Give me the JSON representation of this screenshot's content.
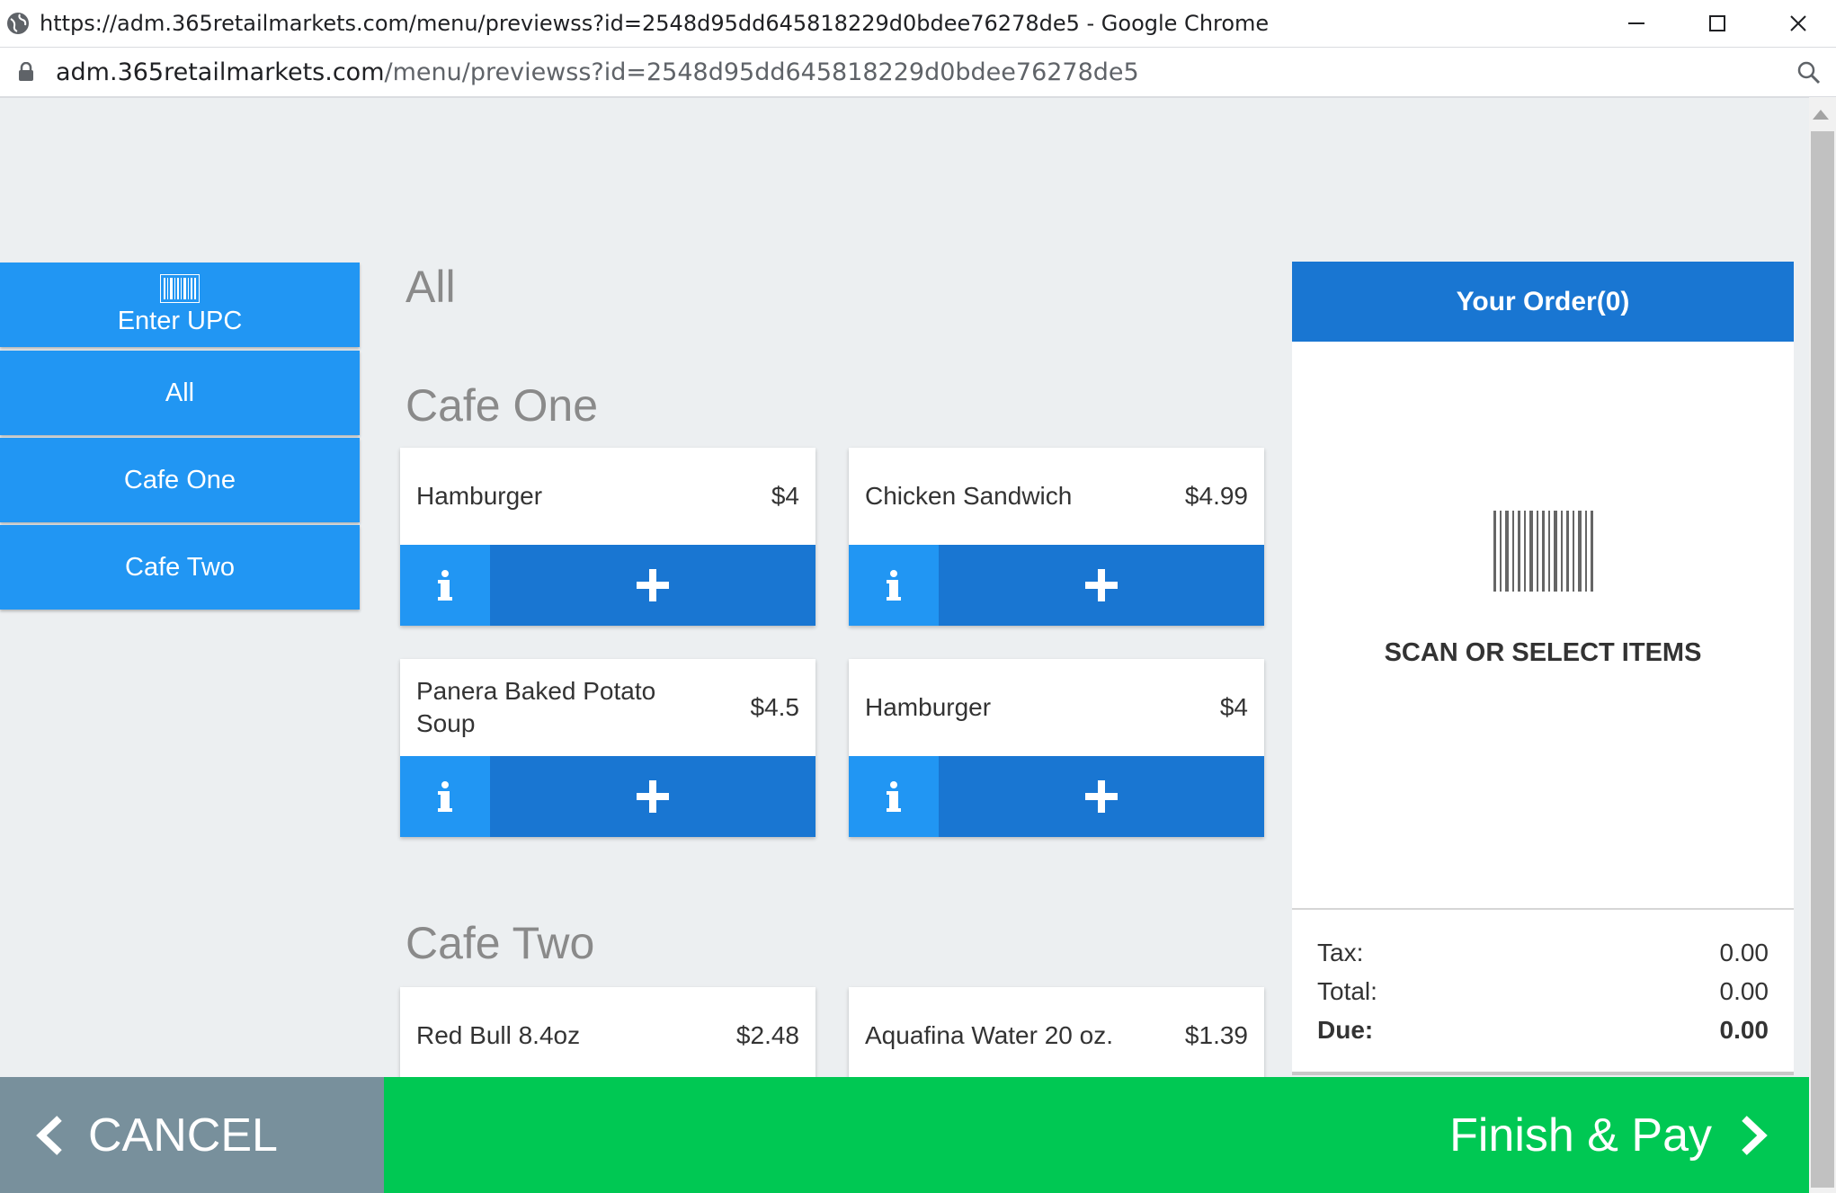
{
  "browser": {
    "window_title": "https://adm.365retailmarkets.com/menu/previewss?id=2548d95dd645818229d0bdee76278de5 - Google Chrome",
    "url_host": "adm.365retailmarkets.com",
    "url_path": "/menu/previewss?id=2548d95dd645818229d0bdee76278de5"
  },
  "sidebar": {
    "upc_label": "Enter UPC",
    "items": [
      {
        "label": "All"
      },
      {
        "label": "Cafe One"
      },
      {
        "label": "Cafe Two"
      }
    ]
  },
  "menu": {
    "current_category": "All",
    "sections": [
      {
        "title": "Cafe One",
        "items": [
          {
            "name": "Hamburger",
            "price": "$4"
          },
          {
            "name": "Chicken Sandwich",
            "price": "$4.99"
          },
          {
            "name": "Panera Baked Potato Soup",
            "price": "$4.5"
          },
          {
            "name": "Hamburger",
            "price": "$4"
          }
        ]
      },
      {
        "title": "Cafe Two",
        "items": [
          {
            "name": "Red Bull 8.4oz",
            "price": "$2.48"
          },
          {
            "name": "Aquafina Water 20 oz.",
            "price": "$1.39"
          }
        ]
      }
    ]
  },
  "order": {
    "title": "Your Order(0)",
    "empty_message": "SCAN OR SELECT ITEMS",
    "tax_label": "Tax:",
    "tax_value": "0.00",
    "total_label": "Total:",
    "total_value": "0.00",
    "due_label": "Due:",
    "due_value": "0.00"
  },
  "footer": {
    "cancel_label": "CANCEL",
    "finish_label": "Finish & Pay"
  },
  "colors": {
    "primary": "#2196f3",
    "primary_dark": "#1976d2",
    "finish_green": "#00c853",
    "cancel_gray": "#78909c"
  },
  "icons": [
    "globe-icon",
    "lock-icon",
    "zoom-icon",
    "barcode-icon",
    "info-icon",
    "plus-icon",
    "chevron-left-icon",
    "chevron-right-icon",
    "minimize-icon",
    "maximize-icon",
    "close-icon"
  ]
}
